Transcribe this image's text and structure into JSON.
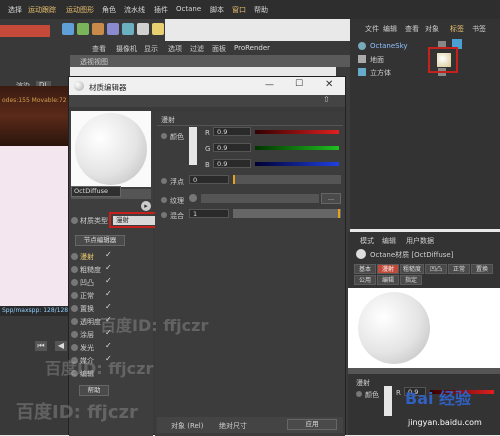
{
  "menubar": {
    "items": [
      "选择",
      "运动跟踪",
      "运动图形",
      "角色",
      "流水线",
      "插件",
      "Octane",
      "脚本",
      "窗口",
      "帮助"
    ]
  },
  "viewport": {
    "menu": [
      "查看",
      "摄像机",
      "显示",
      "选项",
      "过滤",
      "面板",
      "ProRender"
    ],
    "title": "透视视图",
    "left_label": "渲染",
    "left_value": "DL",
    "stats_text": "odes:155 Movable:72",
    "bottom_stats": "Spp/maxspp: 128/128"
  },
  "object_manager": {
    "menu": [
      "文件",
      "编辑",
      "查看",
      "对象",
      "标签",
      "书签"
    ],
    "items": [
      {
        "label": "OctaneSky"
      },
      {
        "label": "地面"
      },
      {
        "label": "立方体"
      }
    ]
  },
  "material_editor": {
    "title": "材质编辑器",
    "material_name": "OctDiffuse",
    "section_title": "漫射",
    "color_label": "颜色",
    "r_label": "R",
    "g_label": "G",
    "b_label": "B",
    "r_value": "0.9",
    "g_value": "0.9",
    "b_value": "0.9",
    "float_label": "浮点",
    "float_value": "0",
    "texture_label": "纹理",
    "mix_label": "混合",
    "mix_value": "1",
    "type_label": "材质类型",
    "type_value": "漫射",
    "node_editor_button": "节点编辑器",
    "channels": [
      "漫射",
      "粗糙度",
      "凹凸",
      "正常",
      "置换",
      "透明度",
      "涂层",
      "发光",
      "媒介",
      "编辑"
    ],
    "bottom_options": [
      "对象 (Rel)",
      "绝对尺寸",
      "应用"
    ],
    "help_button": "帮助"
  },
  "attribute_manager": {
    "menu": [
      "模式",
      "编辑",
      "用户数据"
    ],
    "title": "Octane材质 [OctDiffuse]",
    "tabs": [
      "基本",
      "漫射",
      "粗糙度",
      "凹凸",
      "正常",
      "置换",
      "公用",
      "编辑",
      "指定"
    ],
    "section_title": "漫射",
    "color_label": "颜色",
    "r_label": "R",
    "r_value": "0.9"
  },
  "watermarks": [
    "百度ID: ffjczr",
    "百度ID: ffjczr",
    "百度ID: ffjczr"
  ],
  "site_caption": "jingyan.baidu.com",
  "logo_text": "Bai 经验"
}
